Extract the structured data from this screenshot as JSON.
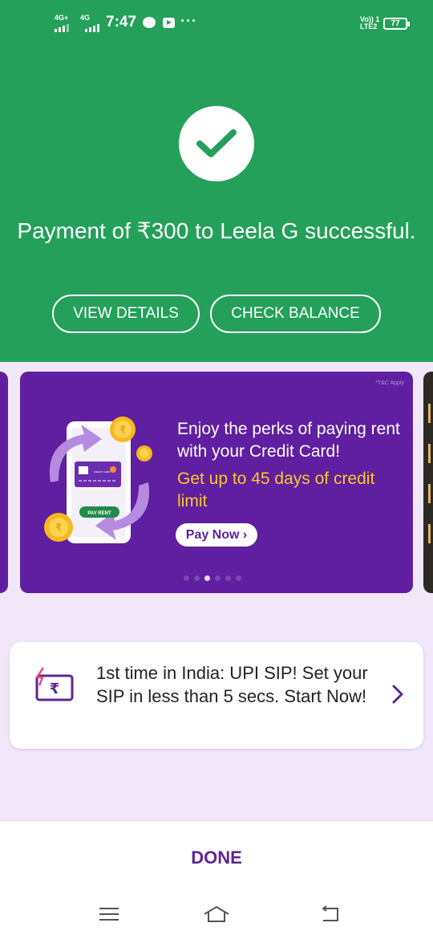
{
  "status_bar": {
    "network1": "4G+",
    "network2": "4G",
    "time": "7:47",
    "volte_line1": "Vo)) 1",
    "volte_line2": "LTE2",
    "battery": "77"
  },
  "header": {
    "title": "Payment of ₹300 to Leela G successful.",
    "view_details": "VIEW DETAILS",
    "check_balance": "CHECK BALANCE",
    "background_color": "#24a05a"
  },
  "promo": {
    "tnc": "*T&C Apply",
    "headline": "Enjoy the perks of paying rent with your Credit Card!",
    "offer": "Get up to 45 days of credit limit",
    "cta": "Pay Now ›",
    "pay_rent_badge": "PAY RENT",
    "card_label": "CREDIT CARD",
    "active_slide": 3,
    "total_slides": 6,
    "background_color": "#5f1fa0",
    "offer_color": "#ffc629"
  },
  "sip": {
    "text": "1st time in India: UPI SIP! Set your SIP in less than 5 secs. Start Now!",
    "icon": "rupee-bolt-icon"
  },
  "footer": {
    "done": "DONE",
    "accent_color": "#5f2596"
  },
  "navbar": {
    "icons": [
      "menu-icon",
      "home-icon",
      "back-icon"
    ]
  }
}
